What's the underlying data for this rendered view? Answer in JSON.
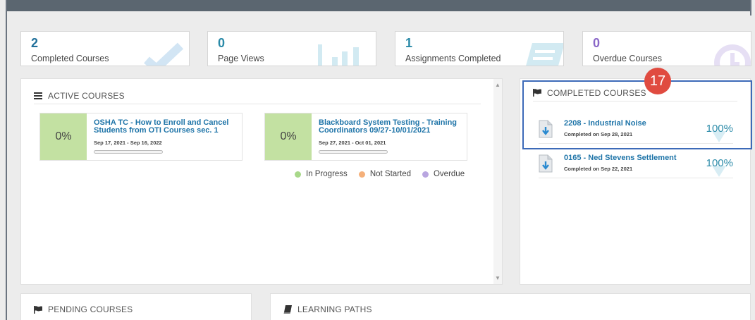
{
  "stats": [
    {
      "value": "2",
      "label": "Completed Courses",
      "icon": "check-icon",
      "color": "#1f6f9a"
    },
    {
      "value": "0",
      "label": "Page Views",
      "icon": "bar-chart-icon",
      "color": "#2a8aa8"
    },
    {
      "value": "1",
      "label": "Assignments Completed",
      "icon": "list-icon",
      "color": "#2a8aa8"
    },
    {
      "value": "0",
      "label": "Overdue Courses",
      "icon": "clock-icon",
      "color": "#8a67c8"
    }
  ],
  "active_courses": {
    "title": "ACTIVE COURSES",
    "courses": [
      {
        "percent": "0%",
        "title": "OSHA TC - How to Enroll and Cancel Students from OTI Courses sec. 1",
        "dates": "Sep 17, 2021 - Sep 16, 2022"
      },
      {
        "percent": "0%",
        "title": "Blackboard System Testing - Training Coordinators 09/27-10/01/2021",
        "dates": "Sep 27, 2021 - Oct 01, 2021"
      }
    ],
    "legend": [
      {
        "label": "In Progress",
        "color": "#a8d88a"
      },
      {
        "label": "Not Started",
        "color": "#f5b07a"
      },
      {
        "label": "Overdue",
        "color": "#b9a6e0"
      }
    ]
  },
  "completed_courses": {
    "title": "COMPLETED COURSES",
    "courses": [
      {
        "name": "2208 - Industrial Noise",
        "completed": "Completed on Sep 28, 2021",
        "percent": "100%"
      },
      {
        "name": "0165 - Ned Stevens Settlement",
        "completed": "Completed on Sep 22, 2021",
        "percent": "100%"
      }
    ]
  },
  "pending_courses": {
    "title": "PENDING COURSES"
  },
  "learning_paths": {
    "title": "LEARNING PATHS"
  },
  "step_badge": "17"
}
